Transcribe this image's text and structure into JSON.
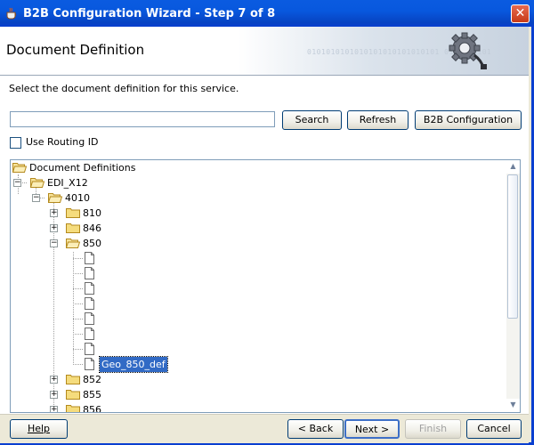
{
  "window": {
    "title": "B2B Configuration Wizard - Step 7 of 8"
  },
  "header": {
    "title": "Document Definition",
    "binary_text": "0101010101010101010101010101 0101010101"
  },
  "instruction": "Select the document definition for this service.",
  "search": {
    "value": "",
    "placeholder": ""
  },
  "buttons": {
    "search": "Search",
    "refresh": "Refresh",
    "b2b_config": "B2B Configuration"
  },
  "routing": {
    "label": "Use Routing ID",
    "checked": false
  },
  "tree": {
    "root": "Document Definitions",
    "edi": "EDI_X12",
    "version": "4010",
    "folders_top": [
      "810",
      "846"
    ],
    "expanded_folder": "850",
    "documents": [
      "",
      "",
      "",
      "",
      "",
      "",
      "",
      "Geo_850_def"
    ],
    "selected": "Geo_850_def",
    "folders_bottom": [
      "852",
      "855",
      "856"
    ]
  },
  "footer": {
    "help": "Help",
    "back": "< Back",
    "next": "Next >",
    "finish": "Finish",
    "cancel": "Cancel"
  }
}
